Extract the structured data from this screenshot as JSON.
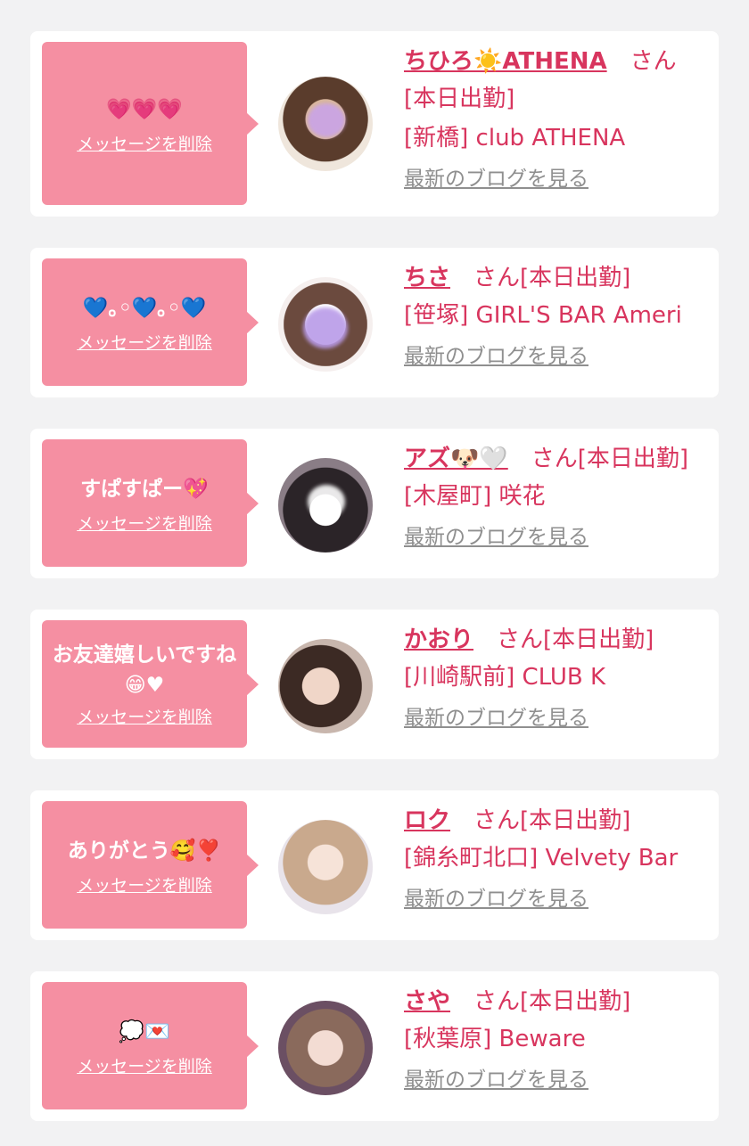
{
  "delete_label": "メッセージを削除",
  "blog_label": "最新のブログを見る",
  "suffix_san": "さん",
  "status_today": "[本日出勤]",
  "colors": {
    "bubble": "#f58fa2",
    "accent": "#d8355e",
    "muted": "#8f8f8f",
    "background": "#f2f2f3"
  },
  "entries": [
    {
      "message": "💗💗💗",
      "name": "ちひろ☀️ATHENA",
      "area_shop": "[新橋] club ATHENA",
      "avatar_icon": "avatar-photo-icon"
    },
    {
      "message": "💙｡◦💙｡◦💙",
      "name": "ちさ",
      "area_shop": "[笹塚] GIRL'S BAR Ameri",
      "avatar_icon": "avatar-photo-icon"
    },
    {
      "message": "すぱすぱー💖",
      "name": "アズ🐶🤍",
      "area_shop": "[木屋町] 咲花",
      "avatar_icon": "avatar-photo-icon"
    },
    {
      "message": "お友達嬉しいですね😁♥",
      "name": "かおり",
      "area_shop": "[川崎駅前] CLUB K",
      "avatar_icon": "avatar-photo-icon"
    },
    {
      "message": "ありがとう🥰❣️",
      "name": "ロク",
      "area_shop": "[錦糸町北口] Velvety Bar",
      "avatar_icon": "avatar-photo-icon"
    },
    {
      "message": "💭💌",
      "name": "さや",
      "area_shop": "[秋葉原] Beware",
      "avatar_icon": "avatar-photo-icon"
    }
  ]
}
